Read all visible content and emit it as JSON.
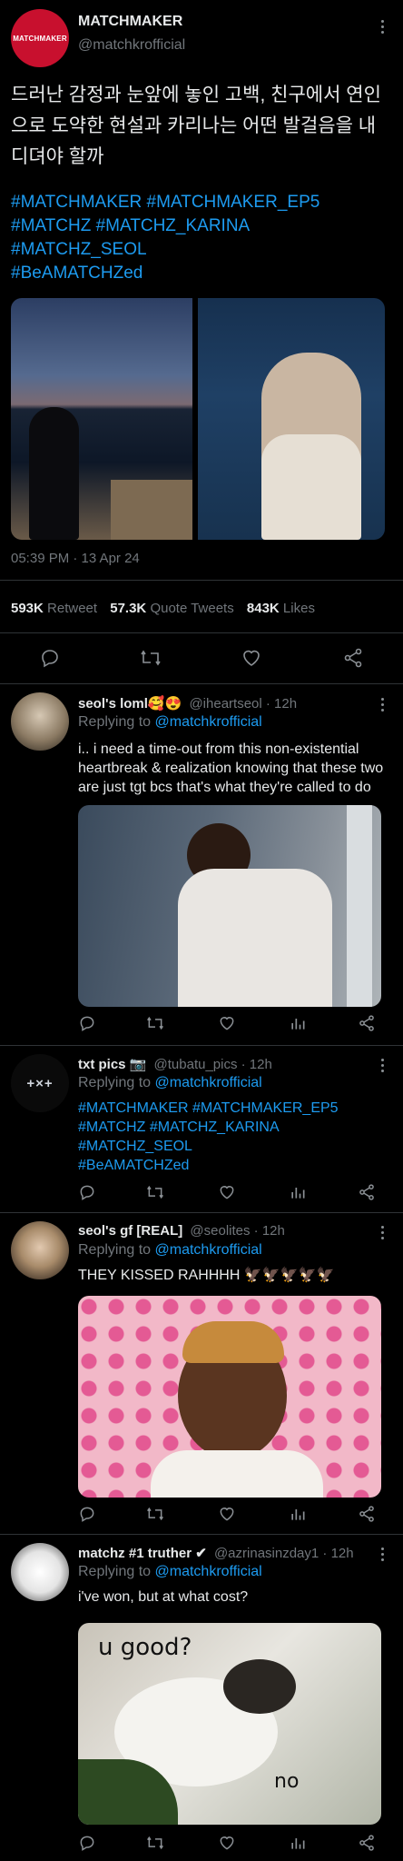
{
  "main": {
    "account_name": "MATCHMAKER",
    "handle": "@matchkrofficial",
    "avatar_logo_text": "MATCHMAKER",
    "text": "드러난 감정과 눈앞에 놓인 고백, 친구에서 연인으로 도약한 현설과 카리나는 어떤 발걸음을 내디뎌야 할까",
    "hashtag_lines": [
      "#MATCHMAKER #MATCHMAKER_EP5",
      "#MATCHZ #MATCHZ_KARINA",
      "#MATCHZ_SEOL",
      "#BeAMATCHZed"
    ],
    "timestamp": "05:39 PM · 13 Apr 24",
    "stats": {
      "retweets_value": "593K",
      "retweets_label": "Retweet",
      "quotes_value": "57.3K",
      "quotes_label": "Quote Tweets",
      "likes_value": "843K",
      "likes_label": "Likes"
    }
  },
  "replies": [
    {
      "name": "seol's loml🥰😍",
      "meta": "@iheartseol · 12h",
      "replying_prefix": "Replying to",
      "replying_handle": "@matchkrofficial",
      "text": "i.. i need a time-out from this non-existential heartbreak & realization knowing that these two are just tgt bcs that's what they're called to do"
    },
    {
      "name": "txt pics 📷",
      "meta": "@tubatu_pics · 12h",
      "replying_prefix": "Replying to",
      "replying_handle": "@matchkrofficial",
      "avatar_text": "+×+",
      "hashtag_lines": [
        "#MATCHMAKER #MATCHMAKER_EP5",
        "#MATCHZ #MATCHZ_KARINA",
        "#MATCHZ_SEOL",
        "#BeAMATCHZed"
      ]
    },
    {
      "name": "seol's gf [REAL]",
      "meta": "@seolites · 12h",
      "replying_prefix": "Replying to",
      "replying_handle": "@matchkrofficial",
      "text": "THEY KISSED RAHHHH 🦅🦅🦅🦅🦅"
    },
    {
      "name": "matchz #1 truther ✔",
      "meta": "@azrinasinzday1 · 12h",
      "replying_prefix": "Replying to",
      "replying_handle": "@matchkrofficial",
      "text": "i've won, but at what cost?",
      "meme_top": "u good?",
      "meme_bottom": "no"
    }
  ]
}
